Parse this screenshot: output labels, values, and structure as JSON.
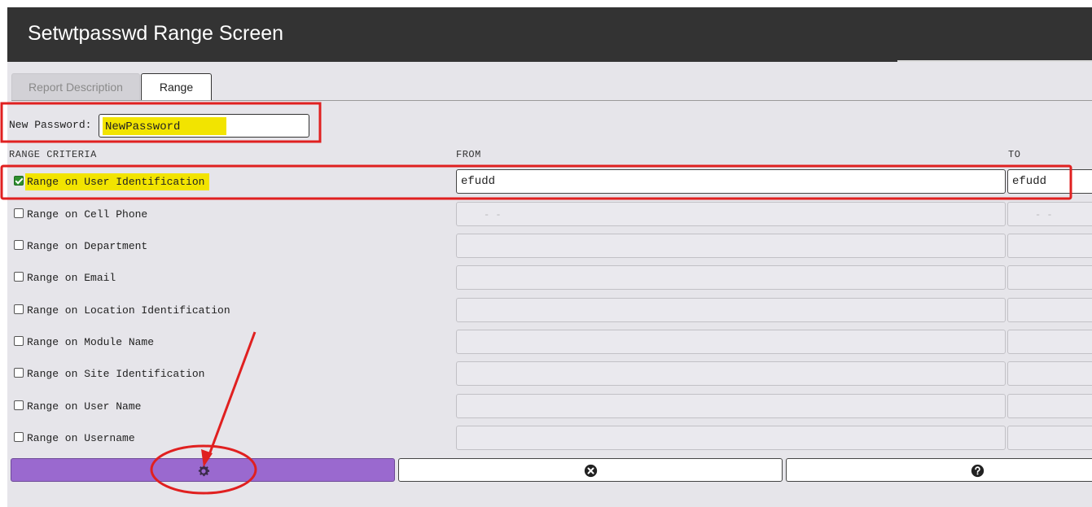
{
  "window": {
    "title": "Setwtpasswd Range Screen"
  },
  "tabs": [
    {
      "label": "Report Description",
      "active": false
    },
    {
      "label": "Range",
      "active": true
    }
  ],
  "password": {
    "label": "New Password:",
    "value": "NewPassword"
  },
  "headers": {
    "criteria": "RANGE CRITERIA",
    "from": "FROM",
    "to": "TO"
  },
  "ranges": [
    {
      "label": "Range on User Identification",
      "checked": true,
      "from": "efudd",
      "to": "efudd"
    },
    {
      "label": "Range on Cell Phone",
      "checked": false,
      "from_mask": "-     -",
      "to_mask": "-     -"
    },
    {
      "label": "Range on Department",
      "checked": false
    },
    {
      "label": "Range on Email",
      "checked": false
    },
    {
      "label": "Range on Location Identification",
      "checked": false
    },
    {
      "label": "Range on Module Name",
      "checked": false
    },
    {
      "label": "Range on Site Identification",
      "checked": false
    },
    {
      "label": "Range on User Name",
      "checked": false
    },
    {
      "label": "Range on Username",
      "checked": false
    }
  ],
  "buttons": {
    "run": {
      "icon": "gear-icon"
    },
    "cancel": {
      "icon": "close-circle-icon"
    },
    "help": {
      "icon": "help-circle-icon"
    }
  },
  "colors": {
    "titlebar": "#333333",
    "run_button": "#9a69cf",
    "highlight": "#f2e400",
    "annotation": "#e02020",
    "checkbox_checked": "#2f8f2f"
  }
}
